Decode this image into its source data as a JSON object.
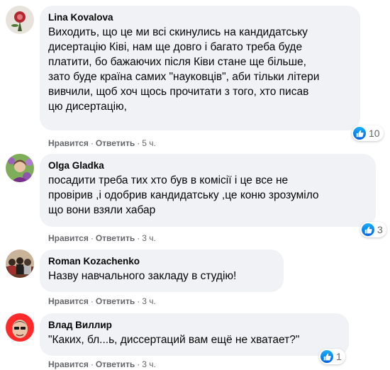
{
  "colors": {
    "bubble": "#f0f2f5",
    "secondary_text": "#65676b",
    "like_blue": "#1877f2"
  },
  "comments": [
    {
      "author": "Lina Kovalova",
      "avatar_icon": "avatar-icon",
      "lines": [
        "Виходить, що це ми всі скинулись на кандидатську",
        "дисертацію Ківі, нам ще довго і багато треба буде",
        "платити, бо бажаючих після Ківи стане ще більше,",
        "зато буде країна самих \"науковців\", аби тільки літери",
        "вивчили, щоб хоч щось прочитати з того, хто писав",
        "цю дисертацію,"
      ],
      "like_label": "Нравится",
      "reply_label": "Ответить",
      "time": "5 ч.",
      "reaction_icon": "like-icon",
      "reaction_count": "10"
    },
    {
      "author": "Olga Gladka",
      "avatar_icon": "avatar-icon",
      "lines": [
        "посадити треба тих хто був в комісії і це все не",
        "провірив ,і одобрив кандидатську ,це коню зрозуміло",
        "що вони взяли хабар"
      ],
      "like_label": "Нравится",
      "reply_label": "Ответить",
      "time": "3 ч.",
      "reaction_icon": "like-icon",
      "reaction_count": "3"
    },
    {
      "author": "Roman Kozachenko",
      "avatar_icon": "avatar-icon",
      "lines": [
        "Назву навчального закладу в студію!"
      ],
      "like_label": "Нравится",
      "reply_label": "Ответить",
      "time": "3 ч."
    },
    {
      "author": "Влад Виллир",
      "avatar_icon": "avatar-icon",
      "lines": [
        "\"Каких, бл...ь, диссертаций вам ещё не хватает?\""
      ],
      "like_label": "Нравится",
      "reply_label": "Ответить",
      "time": "3 ч.",
      "reaction_icon": "like-icon",
      "reaction_count": "1"
    }
  ]
}
